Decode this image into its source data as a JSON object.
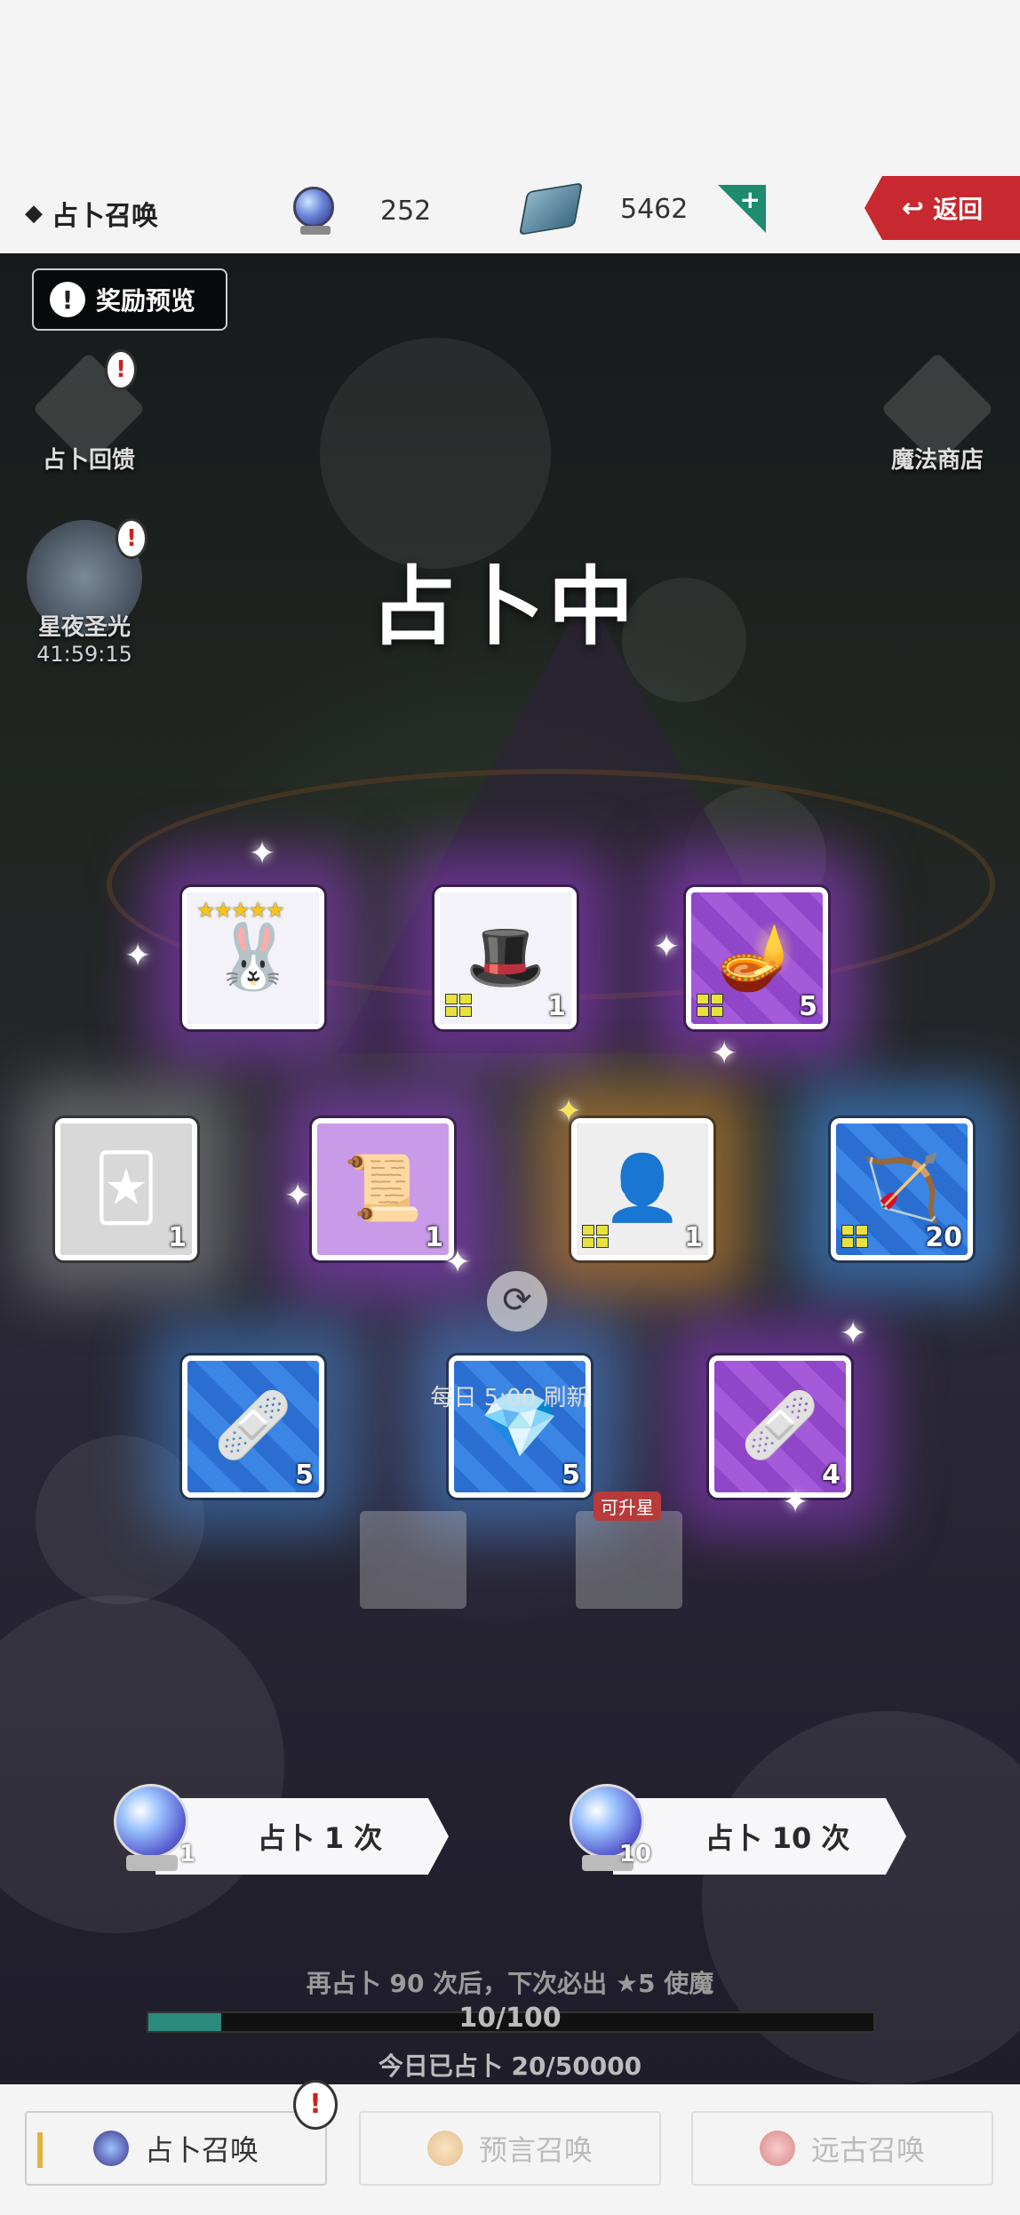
{
  "header": {
    "title": "占卜召唤",
    "orbs": "252",
    "gems": "5462",
    "back": "返回"
  },
  "side": {
    "reward_preview": "奖励预览",
    "feedback": "占卜回馈",
    "star_night": "星夜圣光",
    "star_night_timer": "41:59:15",
    "magic_shop": "魔法商店"
  },
  "state_text": "占卜中",
  "cards": [
    {
      "id": "c1",
      "count": ""
    },
    {
      "id": "c2",
      "count": "1"
    },
    {
      "id": "c3",
      "count": "5"
    },
    {
      "id": "c4",
      "count": "1"
    },
    {
      "id": "c5",
      "count": "1"
    },
    {
      "id": "c6",
      "count": "1"
    },
    {
      "id": "c7",
      "count": "20"
    },
    {
      "id": "c8",
      "count": "5"
    },
    {
      "id": "c9",
      "count": "5"
    },
    {
      "id": "c10",
      "count": "4"
    }
  ],
  "mini": {
    "tag_right": "可升星"
  },
  "daily_refresh": "每日 5:00 刷新",
  "summon": {
    "one_label": "占卜 1 次",
    "one_cost": "1",
    "ten_label": "占卜 10 次",
    "ten_cost": "10"
  },
  "pity_text": "再占卜 90 次后，下次必出 ★5 使魔",
  "progress": {
    "text": "10/100",
    "fraction": 0.1
  },
  "today_text": "今日已占卜 20/50000",
  "tabs": [
    {
      "label": "占卜召唤"
    },
    {
      "label": "预言召唤"
    },
    {
      "label": "远古召唤"
    }
  ],
  "colors": {
    "purple": "#8f46c9",
    "blue": "#2b6ed2",
    "progress": "#2b8a7e",
    "back": "#c8282f"
  }
}
